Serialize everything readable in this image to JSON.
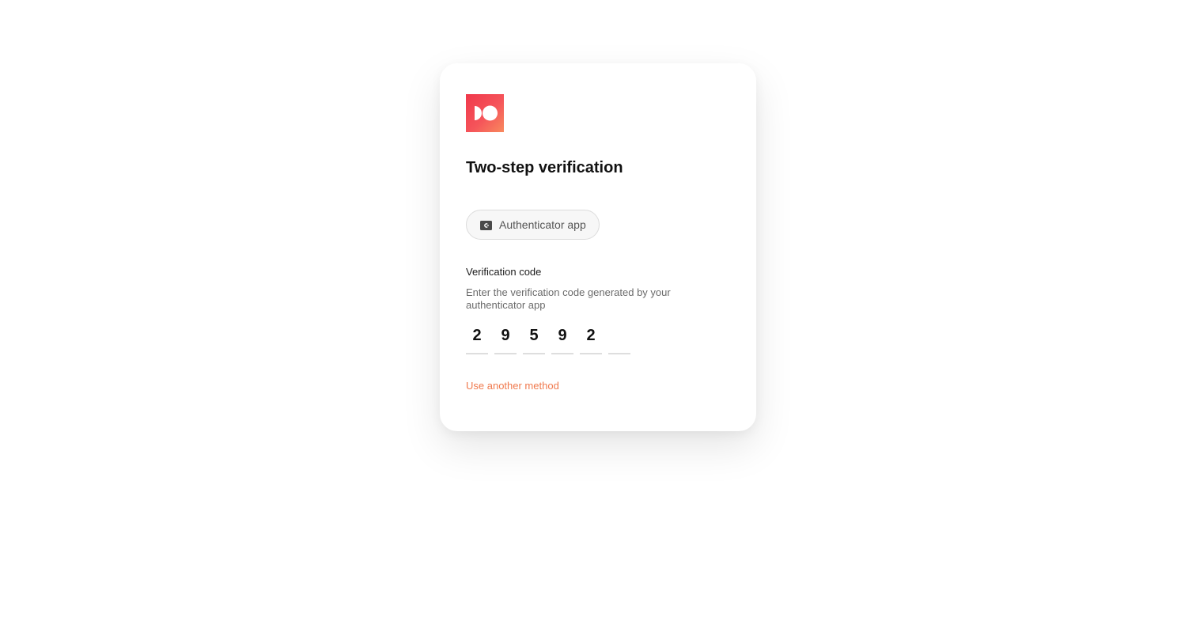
{
  "brand": {
    "logo_icon": "brand-logo-icon",
    "gradient_start": "#f0384b",
    "gradient_end": "#f88a5e"
  },
  "title": "Two-step verification",
  "method": {
    "label": "Authenticator app",
    "icon": "authenticator-app-icon"
  },
  "verification": {
    "label": "Verification code",
    "help": "Enter the verification code generated by your authenticator app",
    "digits": [
      "2",
      "9",
      "5",
      "9",
      "2",
      ""
    ]
  },
  "alt_method_link": "Use another method",
  "colors": {
    "accent_link": "#f07a4e",
    "title_text": "#111111",
    "help_text": "#6b6b6b"
  }
}
